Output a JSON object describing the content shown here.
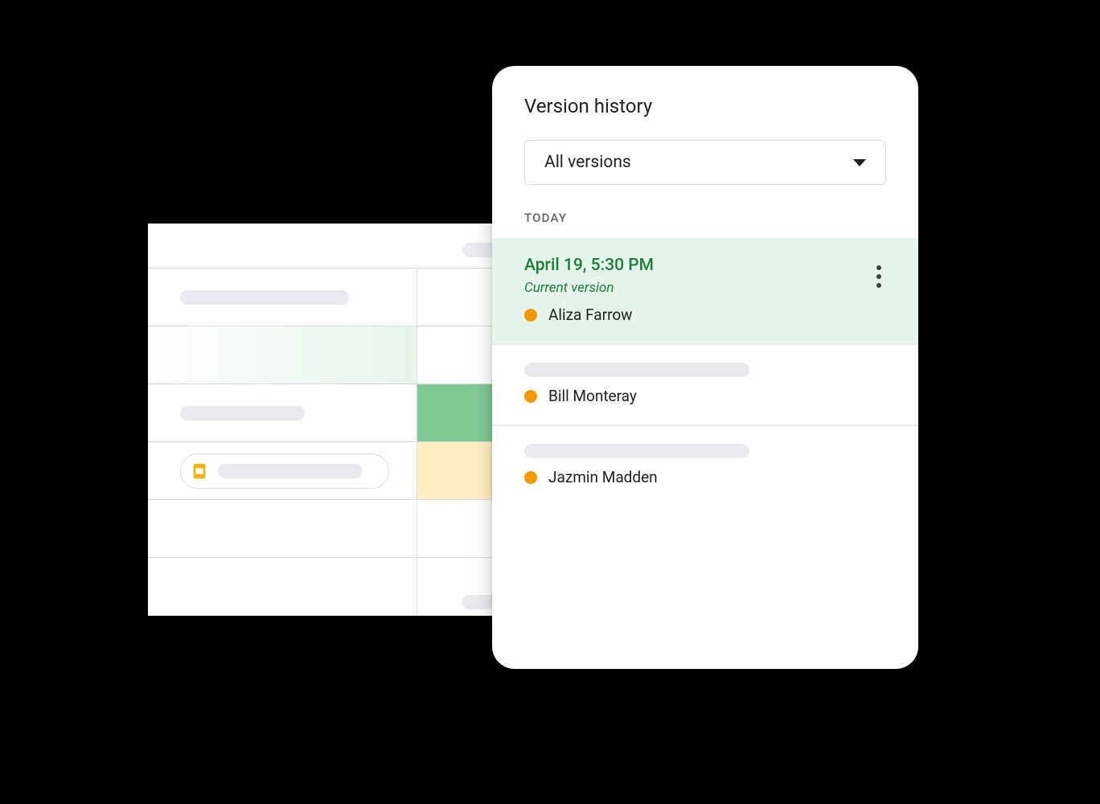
{
  "panel": {
    "title": "Version history",
    "dropdown": {
      "selected": "All versions"
    },
    "section_label": "TODAY",
    "versions": [
      {
        "timestamp": "April 19, 5:30 PM",
        "sublabel": "Current version",
        "author": "Aliza Farrow",
        "color": "#f29900",
        "active": true
      },
      {
        "author": "Bill Monteray",
        "color": "#f29900"
      },
      {
        "author": "Jazmin Madden",
        "color": "#f29900"
      }
    ]
  },
  "icons": {
    "slides": "slides-icon",
    "more": "more-vertical-icon",
    "dropdown": "chevron-down-icon"
  }
}
